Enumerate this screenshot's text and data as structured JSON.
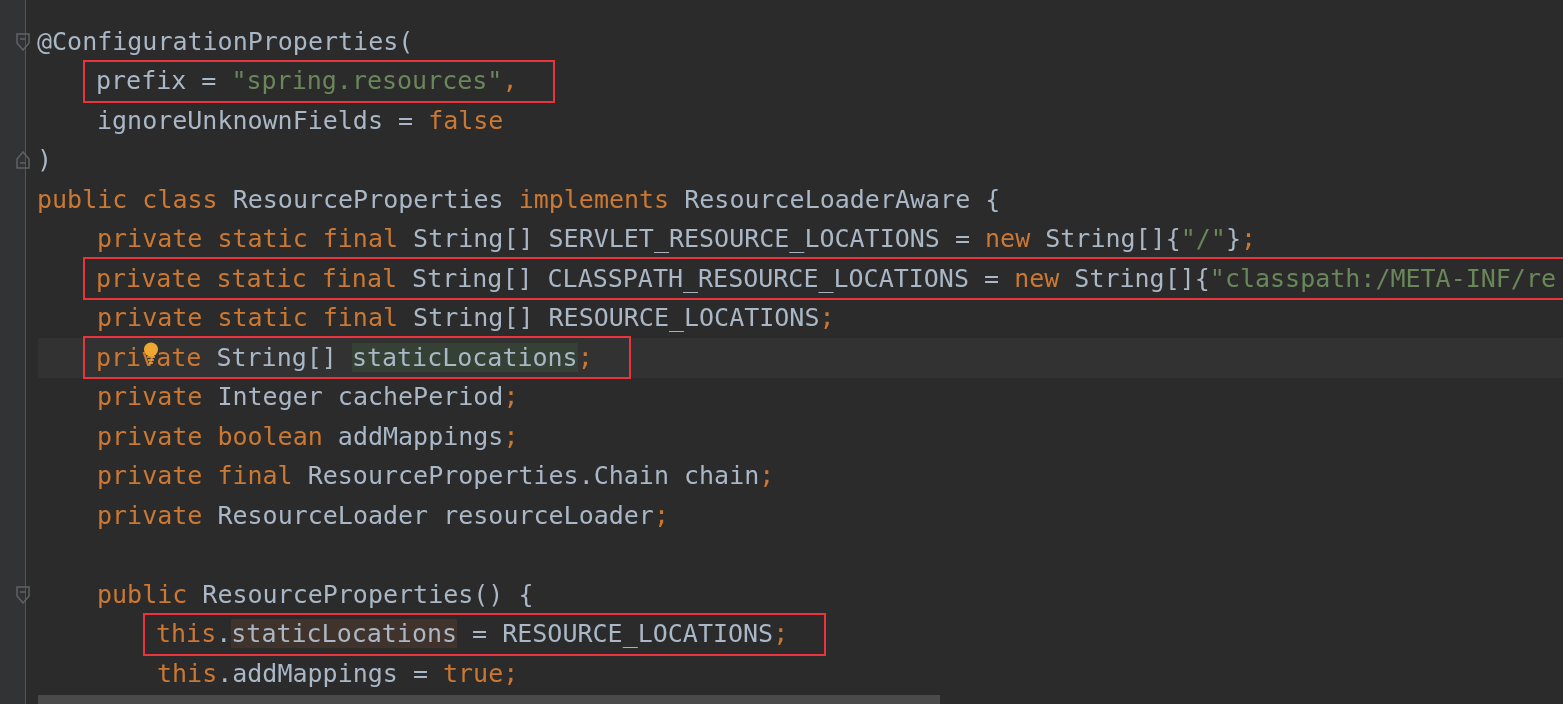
{
  "editor": {
    "lines": [
      {
        "fold_open": true,
        "tokens": [
          {
            "kind": "plain",
            "text": "@ConfigurationProperties("
          }
        ],
        "children": [
          {
            "boxed": true,
            "tokens": [
              {
                "kind": "plain",
                "text": "prefix = "
              },
              {
                "kind": "string",
                "text": "\"spring.resources\""
              },
              {
                "kind": "punct",
                "text": ","
              }
            ]
          },
          {
            "tokens": [
              {
                "kind": "plain",
                "text": "ignoreUnknownFields = "
              },
              {
                "kind": "keyword",
                "text": "false"
              }
            ]
          }
        ]
      },
      {
        "fold_close": true,
        "tokens": [
          {
            "kind": "plain",
            "text": ")"
          }
        ]
      },
      {
        "tokens": [
          {
            "kind": "keyword",
            "text": "public class "
          },
          {
            "kind": "plain",
            "text": "ResourceProperties "
          },
          {
            "kind": "keyword",
            "text": "implements "
          },
          {
            "kind": "plain",
            "text": "ResourceLoaderAware {"
          }
        ],
        "children": [
          {
            "tokens": [
              {
                "kind": "keyword",
                "text": "private static final "
              },
              {
                "kind": "plain",
                "text": "String[] SERVLET_RESOURCE_LOCATIONS = "
              },
              {
                "kind": "keyword",
                "text": "new "
              },
              {
                "kind": "plain",
                "text": "String[]{"
              },
              {
                "kind": "string",
                "text": "\"/\""
              },
              {
                "kind": "plain",
                "text": "}"
              },
              {
                "kind": "punct",
                "text": ";"
              }
            ]
          },
          {
            "boxed": true,
            "tokens": [
              {
                "kind": "keyword",
                "text": "private static final "
              },
              {
                "kind": "plain",
                "text": "String[] CLASSPATH_RESOURCE_LOCATIONS = "
              },
              {
                "kind": "keyword",
                "text": "new "
              },
              {
                "kind": "plain",
                "text": "String[]{"
              },
              {
                "kind": "string",
                "text": "\"classpath:/META-INF/re"
              }
            ]
          },
          {
            "tokens": [
              {
                "kind": "keyword",
                "text": "private static final "
              },
              {
                "kind": "plain",
                "text": "String[] RESOURCE_LOCATIONS"
              },
              {
                "kind": "punct",
                "text": ";"
              }
            ]
          },
          {
            "boxed": true,
            "current": true,
            "bulb": true,
            "tokens": [
              {
                "kind": "keyword",
                "text": "private "
              },
              {
                "kind": "plain",
                "text": "String[] "
              },
              {
                "kind": "read-usage",
                "text": "staticLocations"
              },
              {
                "kind": "punct",
                "text": ";"
              }
            ]
          },
          {
            "tokens": [
              {
                "kind": "keyword",
                "text": "private "
              },
              {
                "kind": "plain",
                "text": "Integer cachePeriod"
              },
              {
                "kind": "punct",
                "text": ";"
              }
            ]
          },
          {
            "tokens": [
              {
                "kind": "keyword",
                "text": "private boolean "
              },
              {
                "kind": "plain",
                "text": "addMappings"
              },
              {
                "kind": "punct",
                "text": ";"
              }
            ]
          },
          {
            "tokens": [
              {
                "kind": "keyword",
                "text": "private final "
              },
              {
                "kind": "plain",
                "text": "ResourceProperties.Chain chain"
              },
              {
                "kind": "punct",
                "text": ";"
              }
            ]
          },
          {
            "tokens": [
              {
                "kind": "keyword",
                "text": "private "
              },
              {
                "kind": "plain",
                "text": "ResourceLoader resourceLoader"
              },
              {
                "kind": "punct",
                "text": ";"
              }
            ]
          },
          {
            "blank": true
          },
          {
            "fold_open": true,
            "tokens": [
              {
                "kind": "keyword",
                "text": "public "
              },
              {
                "kind": "plain",
                "text": "ResourceProperties() {"
              }
            ],
            "children": [
              {
                "boxed": true,
                "tokens": [
                  {
                    "kind": "keyword",
                    "text": "this"
                  },
                  {
                    "kind": "plain",
                    "text": "."
                  },
                  {
                    "kind": "write-usage",
                    "text": "staticLocations"
                  },
                  {
                    "kind": "plain",
                    "text": " = RESOURCE_LOCATIONS"
                  },
                  {
                    "kind": "punct",
                    "text": ";"
                  }
                ]
              },
              {
                "tokens": [
                  {
                    "kind": "keyword",
                    "text": "this"
                  },
                  {
                    "kind": "plain",
                    "text": ".addMappings = "
                  },
                  {
                    "kind": "keyword",
                    "text": "true"
                  },
                  {
                    "kind": "punct",
                    "text": ";"
                  }
                ]
              }
            ]
          }
        ]
      }
    ]
  }
}
